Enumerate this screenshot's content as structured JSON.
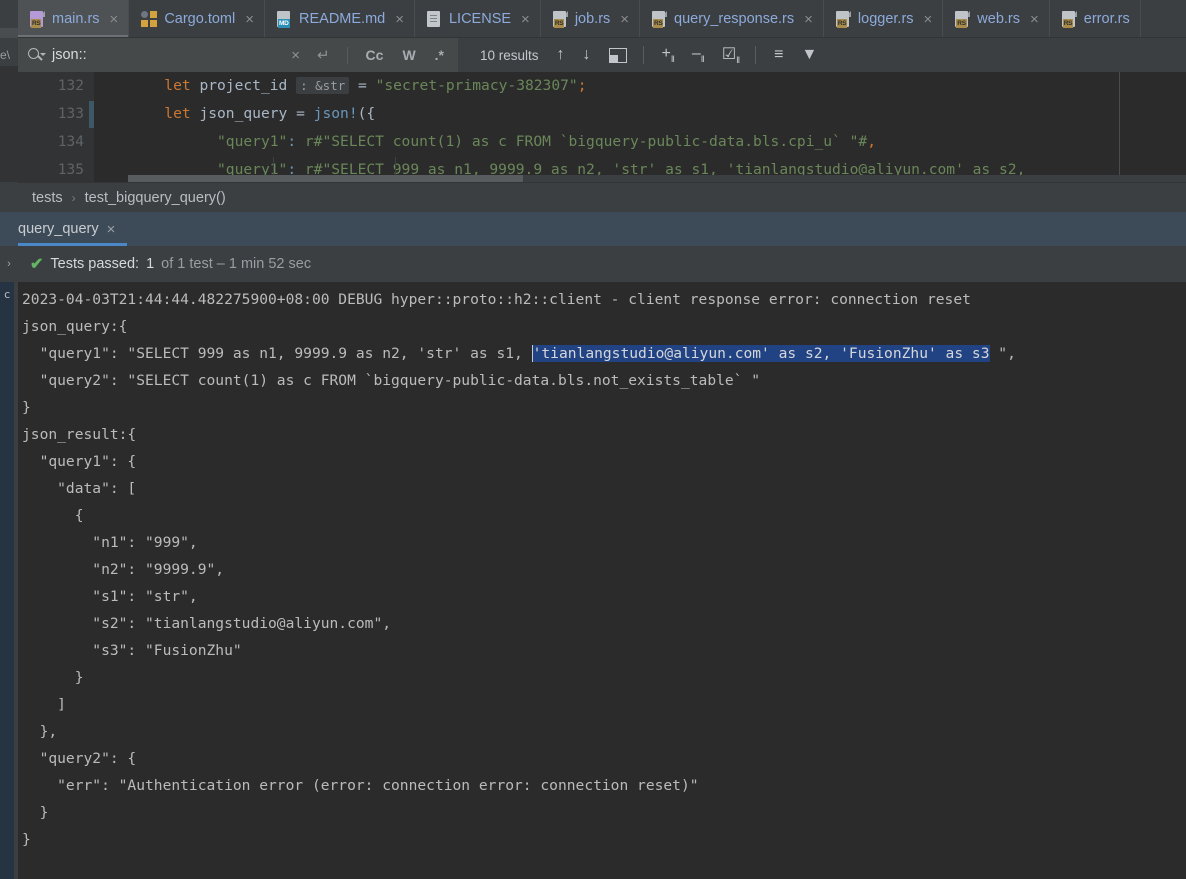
{
  "tabs": [
    {
      "label": "main.rs",
      "icon": "rust-file-icon",
      "icon_kind": "rs-purple",
      "active": true,
      "close": "×"
    },
    {
      "label": "Cargo.toml",
      "icon": "toml-file-icon",
      "icon_kind": "toml",
      "active": false,
      "close": "×"
    },
    {
      "label": "README.md",
      "icon": "markdown-file-icon",
      "icon_kind": "md",
      "active": false,
      "close": "×"
    },
    {
      "label": "LICENSE",
      "icon": "text-file-icon",
      "icon_kind": "plain",
      "active": false,
      "close": "×"
    },
    {
      "label": "job.rs",
      "icon": "rust-file-icon",
      "icon_kind": "rs",
      "active": false,
      "close": "×"
    },
    {
      "label": "query_response.rs",
      "icon": "rust-file-icon",
      "icon_kind": "rs",
      "active": false,
      "close": "×"
    },
    {
      "label": "logger.rs",
      "icon": "rust-file-icon",
      "icon_kind": "rs",
      "active": false,
      "close": "×"
    },
    {
      "label": "web.rs",
      "icon": "rust-file-icon",
      "icon_kind": "rs",
      "active": false,
      "close": "×"
    },
    {
      "label": "error.rs",
      "icon": "rust-file-icon",
      "icon_kind": "rs",
      "active": false,
      "close": ""
    }
  ],
  "left_strip": {
    "partial_label": "e\\",
    "vertical_label": "c",
    "expand_arrow": "›"
  },
  "search": {
    "value": "json::",
    "placeholder": "Search",
    "clear_label": "×",
    "newline_label": "↵",
    "match_case_label": "Cc",
    "words_label": "W",
    "regex_label": ".*",
    "results_label": "10 results",
    "prev_label": "↑",
    "next_label": "↓",
    "select_all_label": "❐",
    "add_line_label": "+",
    "remove_line_label": "−",
    "check_line_label": "☑",
    "sort_label": "≡",
    "filter_label": "▼"
  },
  "editor": {
    "line_numbers": [
      "132",
      "133",
      "134",
      "135"
    ],
    "lines": [
      {
        "n": "132",
        "segments": [
          {
            "t": "        ",
            "c": "punc"
          },
          {
            "t": "let",
            "c": "kw"
          },
          {
            "t": " project_id ",
            "c": "punc"
          },
          {
            "t": ": &str",
            "c": "hint"
          },
          {
            "t": " = ",
            "c": "punc"
          },
          {
            "t": "\"secret-primacy-382307\"",
            "c": "str"
          },
          {
            "t": ";",
            "c": "kw"
          }
        ]
      },
      {
        "n": "133",
        "segments": [
          {
            "t": "        ",
            "c": "punc"
          },
          {
            "t": "let",
            "c": "kw"
          },
          {
            "t": " json_query = ",
            "c": "punc"
          },
          {
            "t": "json!",
            "c": "fn"
          },
          {
            "t": "({",
            "c": "punc"
          }
        ]
      },
      {
        "n": "134",
        "segments": [
          {
            "t": "              ",
            "c": "punc"
          },
          {
            "t": "\"query1\"",
            "c": "str"
          },
          {
            "t": ": ",
            "c": "fn"
          },
          {
            "t": "r#\"SELECT count(1) as c FROM `bigquery-public-data.bls.cpi_u` \"#",
            "c": "str"
          },
          {
            "t": ",",
            "c": "kw"
          }
        ]
      },
      {
        "n": "135",
        "segments": [
          {
            "t": "              ",
            "c": "punc"
          },
          {
            "t": "\"query1\"",
            "c": "str"
          },
          {
            "t": ": ",
            "c": "fn"
          },
          {
            "t": "r#\"SELECT 999 as n1, 9999.9 as n2, 'str' as s1, 'tianlangstudio@aliyun.com' as s2,",
            "c": "str"
          }
        ]
      }
    ]
  },
  "breadcrumb": {
    "items": [
      "tests",
      "test_bigquery_query()"
    ],
    "separator": "›"
  },
  "run_tab": {
    "label": "query_query",
    "close": "×"
  },
  "status": {
    "check": "✔",
    "text": "Tests passed:",
    "count": "1",
    "detail": "of 1 test – 1 min 52 sec"
  },
  "console": {
    "lines": [
      {
        "text": "2023-04-03T21:44:44.482275900+08:00 DEBUG hyper::proto::h2::client - client response error: connection reset"
      },
      {
        "text": "json_query:{"
      },
      {
        "pre": "  \"query1\": \"SELECT 999 as n1, 9999.9 as n2, 'str' as s1, ",
        "sel": "'tianlangstudio@aliyun.com' as s2, 'FusionZhu' as s3",
        "post": " \","
      },
      {
        "text": "  \"query2\": \"SELECT count(1) as c FROM `bigquery-public-data.bls.not_exists_table` \""
      },
      {
        "text": "}"
      },
      {
        "text": "json_result:{"
      },
      {
        "text": "  \"query1\": {"
      },
      {
        "text": "    \"data\": ["
      },
      {
        "text": "      {"
      },
      {
        "text": "        \"n1\": \"999\","
      },
      {
        "text": "        \"n2\": \"9999.9\","
      },
      {
        "text": "        \"s1\": \"str\","
      },
      {
        "text": "        \"s2\": \"tianlangstudio@aliyun.com\","
      },
      {
        "text": "        \"s3\": \"FusionZhu\""
      },
      {
        "text": "      }"
      },
      {
        "text": "    ]"
      },
      {
        "text": "  },"
      },
      {
        "text": "  \"query2\": {"
      },
      {
        "text": "    \"err\": \"Authentication error (error: connection error: connection reset)\""
      },
      {
        "text": "  }"
      },
      {
        "text": "}"
      }
    ]
  },
  "colors": {
    "background": "#2b2b2b",
    "chrome": "#3c3f41",
    "selection": "#214283",
    "accent": "#4a88c7",
    "success": "#62b562",
    "string": "#6a8759",
    "keyword": "#cc7832",
    "function": "#6897bb",
    "tab_text": "#8caadc"
  }
}
